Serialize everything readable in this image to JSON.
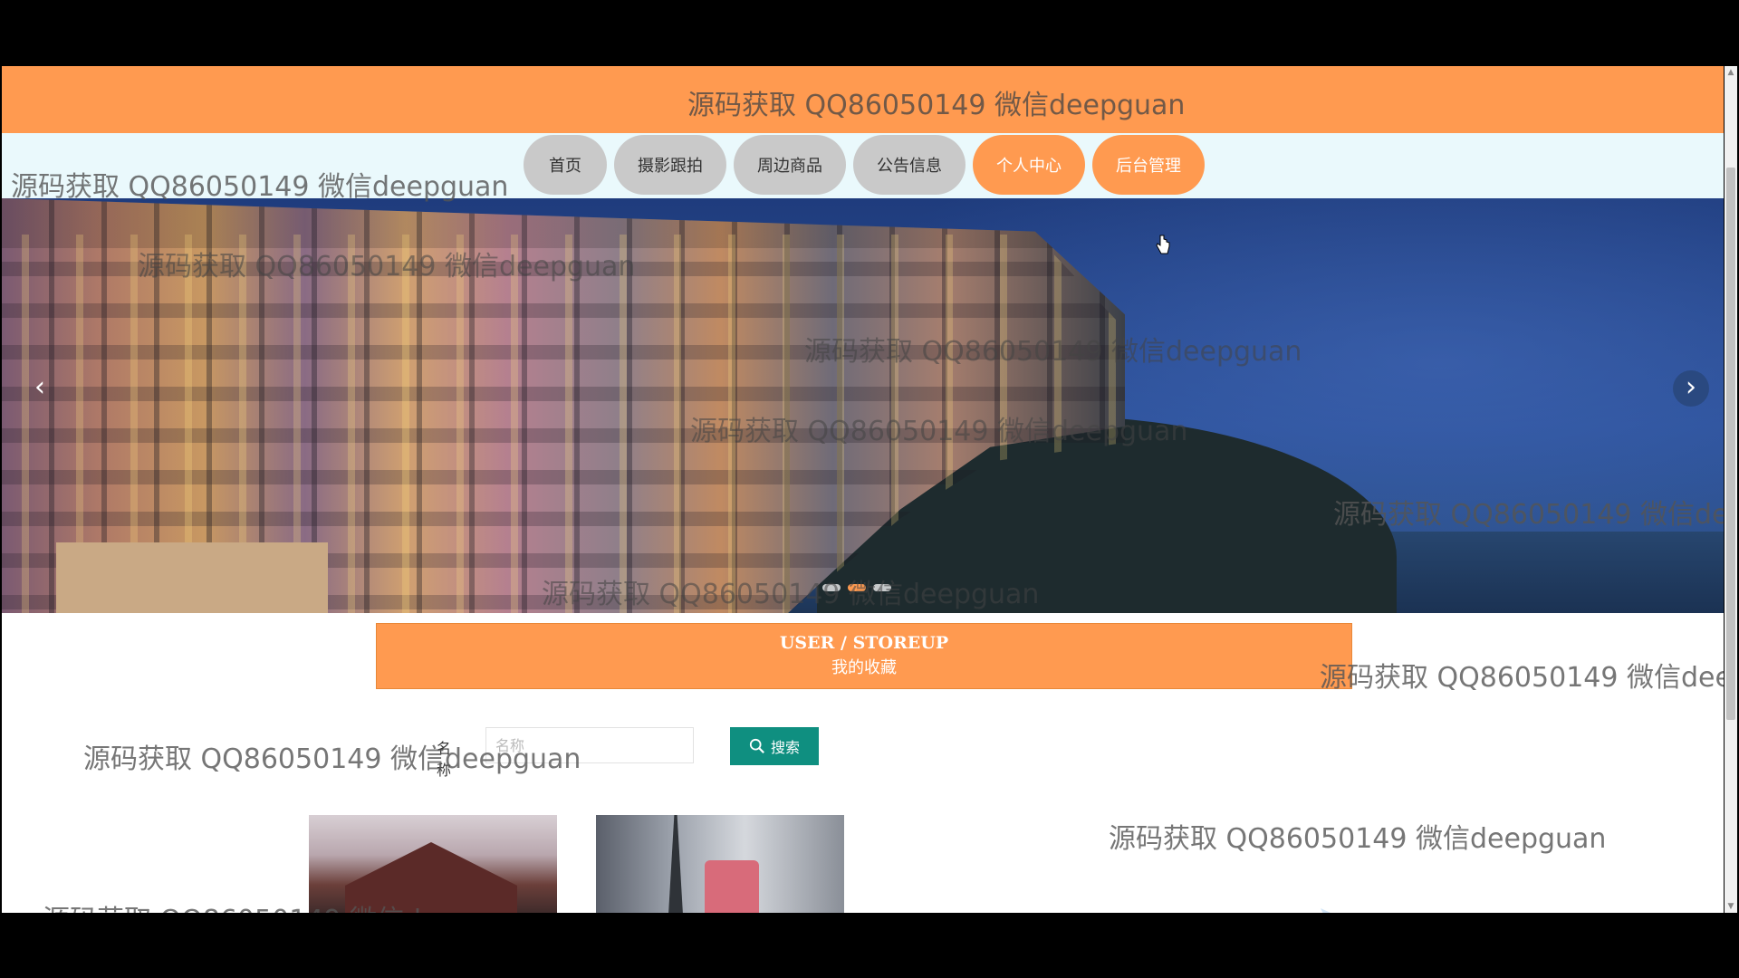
{
  "site": {
    "title": ""
  },
  "nav": {
    "items": [
      {
        "label": "首页"
      },
      {
        "label": "摄影跟拍"
      },
      {
        "label": "周边商品"
      },
      {
        "label": "公告信息"
      },
      {
        "label": "个人中心"
      },
      {
        "label": "后台管理"
      }
    ]
  },
  "carousel": {
    "dots": 3,
    "active_dot": 1
  },
  "section": {
    "title_en": "USER / STOREUP",
    "title_zh": "我的收藏"
  },
  "search": {
    "label": "名称",
    "placeholder": "名称",
    "value": "",
    "button_label": "搜索"
  },
  "watermark_text": "源码获取 QQ86050149 微信deepguan",
  "colors": {
    "accent": "#ff9a50",
    "search_button": "#0f8f80",
    "nav_inactive": "#c9c9c9",
    "nav_band": "#eaf9fc"
  },
  "icons": [
    "chevron-left-icon",
    "chevron-right-icon",
    "search-icon",
    "cursor-icon",
    "play-icon"
  ]
}
